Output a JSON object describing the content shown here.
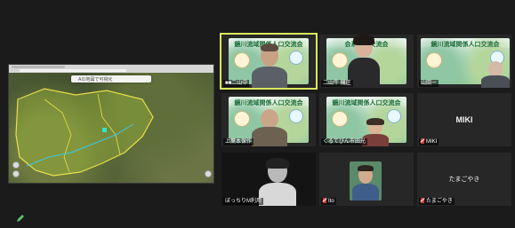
{
  "shared_screen": {
    "map_title": "Aの地図で可視化"
  },
  "tiles": [
    {
      "name": "■■二山中",
      "muted": false,
      "poster_title": "鏡川流域関係人口交流会"
    },
    {
      "name": "二山牛 機圧",
      "muted": false,
      "poster_title": "会系人口交流会"
    },
    {
      "name": "山田ー",
      "muted": false,
      "poster_title": "鏡川流域関係人口交流会"
    },
    {
      "name": "上葉本保作",
      "muted": false,
      "poster_title": "鏡川流域関係人口交流会"
    },
    {
      "name": "くるてびん市田光",
      "muted": false,
      "poster_title": "鏡川流域関係人口交流会"
    },
    {
      "name": "MIKI",
      "muted": true,
      "display": "MIKI"
    },
    {
      "name": "ぼっちりM利用",
      "muted": false
    },
    {
      "name": "Ito",
      "muted": true
    },
    {
      "name": "たまごやき",
      "muted": true,
      "display": "たまごやき"
    }
  ],
  "colors": {
    "background": "#1b1b1b",
    "tile": "#272727",
    "active_border": "#d9e85b",
    "muted_red": "#e23b3b",
    "poster_green": "#1c6e3a"
  },
  "icons": {
    "bottom_left": "pencil-icon",
    "muted": "mic-muted-icon"
  }
}
